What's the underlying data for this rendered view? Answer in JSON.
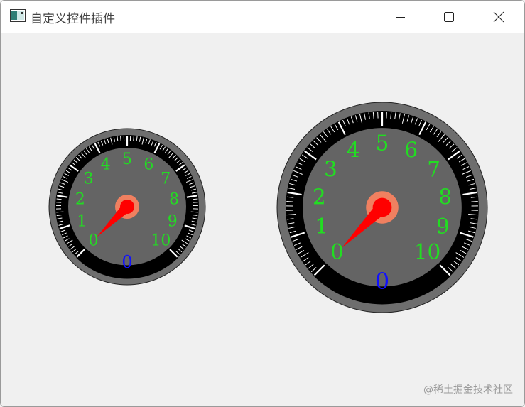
{
  "window": {
    "title": "自定义控件插件",
    "icon": "app-window-icon",
    "controls": [
      "minimize-icon",
      "maximize-icon",
      "close-icon"
    ]
  },
  "gauges": [
    {
      "scale_labels": [
        "0",
        "1",
        "2",
        "3",
        "4",
        "5",
        "6",
        "7",
        "8",
        "9",
        "10"
      ],
      "value": 0,
      "value_text": "0",
      "label_color": "#22dd22",
      "value_color": "#1010ff",
      "needle_color": "#ff0000",
      "hub_outer_color": "#f08060",
      "face_color": "#646464"
    },
    {
      "scale_labels": [
        "0",
        "1",
        "2",
        "3",
        "4",
        "5",
        "6",
        "7",
        "8",
        "9",
        "10"
      ],
      "value": 0,
      "value_text": "0",
      "label_color": "#22dd22",
      "value_color": "#1010ff",
      "needle_color": "#ff0000",
      "hub_outer_color": "#f08060",
      "face_color": "#646464"
    }
  ],
  "watermark": "@稀土掘金技术社区"
}
